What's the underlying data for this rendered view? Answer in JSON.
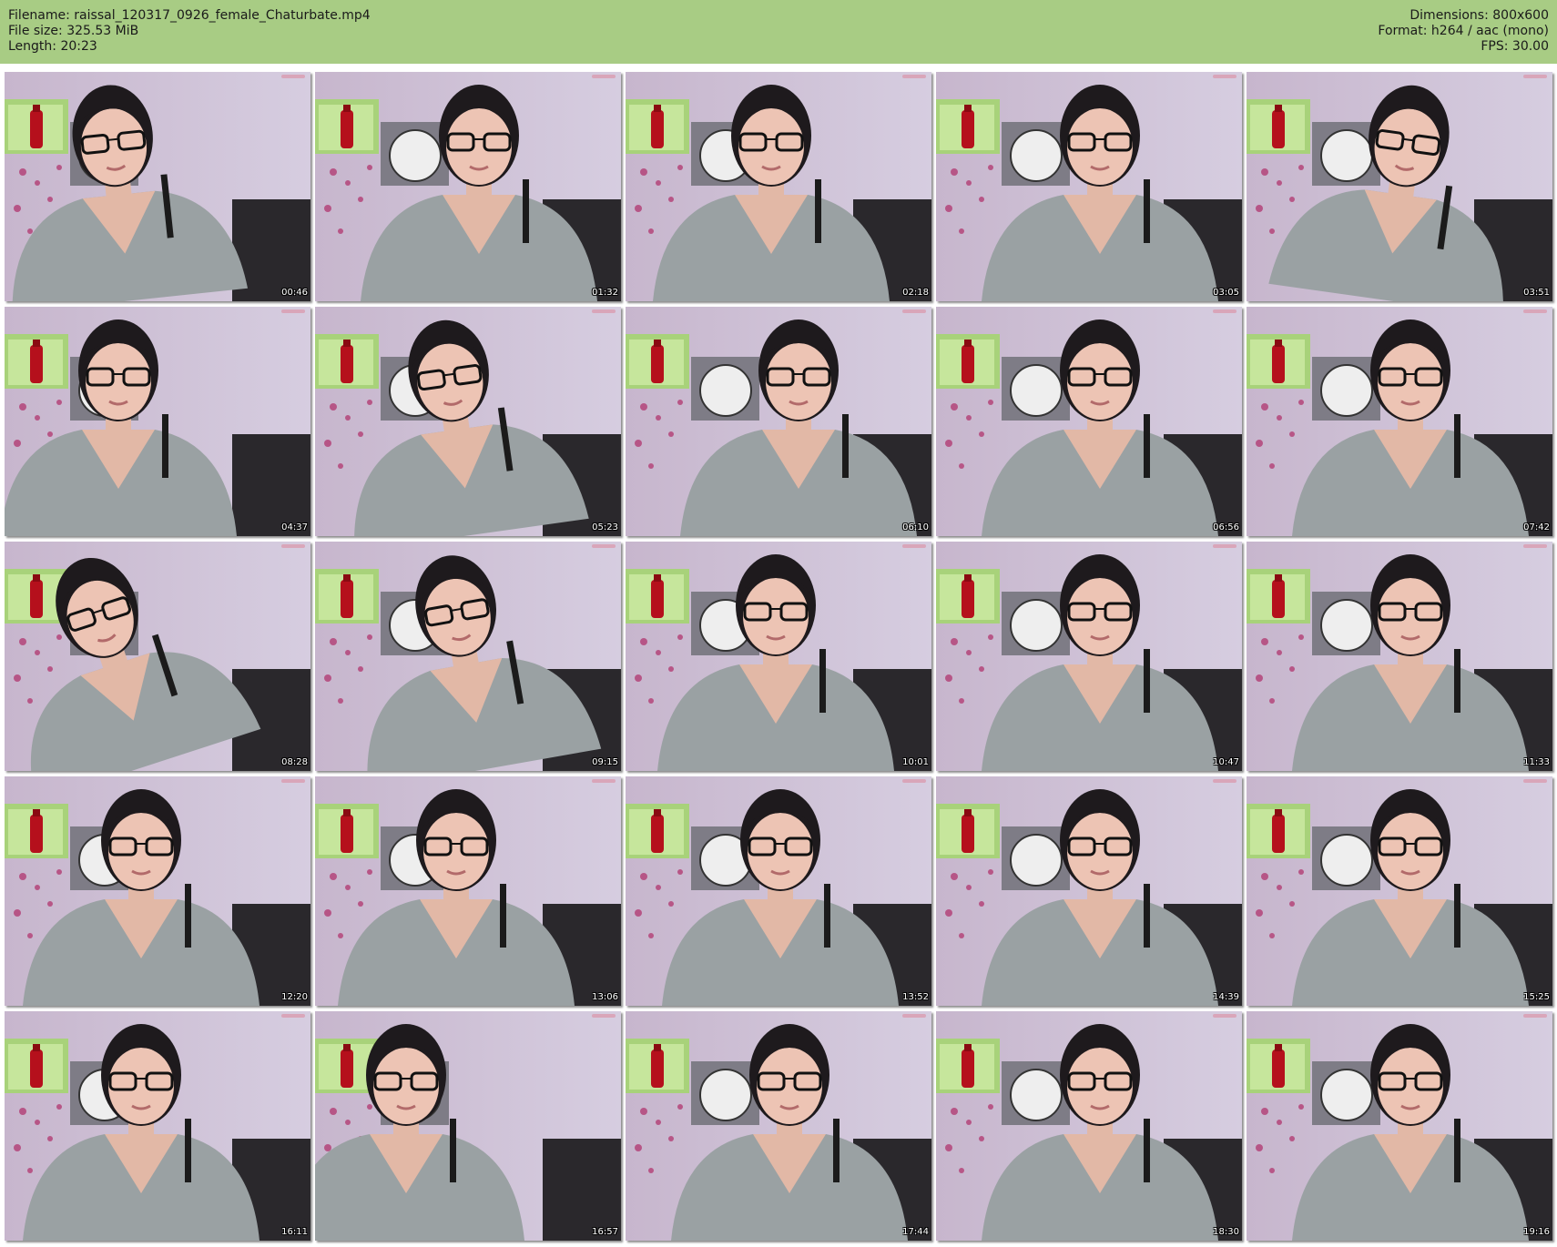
{
  "header": {
    "filename_line": "Filename: raissal_120317_0926_female_Chaturbate.mp4",
    "filesize_line": "File size: 325.53 MiB",
    "length_line": "Length: 20:23",
    "dimensions_line": "Dimensions: 800x600",
    "format_line": "Format: h264 / aac (mono)",
    "fps_line": "FPS: 30.00"
  },
  "colors": {
    "header_bg": "#a8cc84",
    "wall": "#cdbfd4",
    "sweater": "#9aa1a3",
    "hair": "#1e1a1d"
  },
  "thumbnails": [
    {
      "timestamp": "00:46"
    },
    {
      "timestamp": "01:32"
    },
    {
      "timestamp": "02:18"
    },
    {
      "timestamp": "03:05"
    },
    {
      "timestamp": "03:51"
    },
    {
      "timestamp": "04:37"
    },
    {
      "timestamp": "05:23"
    },
    {
      "timestamp": "06:10"
    },
    {
      "timestamp": "06:56"
    },
    {
      "timestamp": "07:42"
    },
    {
      "timestamp": "08:28"
    },
    {
      "timestamp": "09:15"
    },
    {
      "timestamp": "10:01"
    },
    {
      "timestamp": "10:47"
    },
    {
      "timestamp": "11:33"
    },
    {
      "timestamp": "12:20"
    },
    {
      "timestamp": "13:06"
    },
    {
      "timestamp": "13:52"
    },
    {
      "timestamp": "14:39"
    },
    {
      "timestamp": "15:25"
    },
    {
      "timestamp": "16:11"
    },
    {
      "timestamp": "16:57"
    },
    {
      "timestamp": "17:44"
    },
    {
      "timestamp": "18:30"
    },
    {
      "timestamp": "19:16"
    }
  ]
}
